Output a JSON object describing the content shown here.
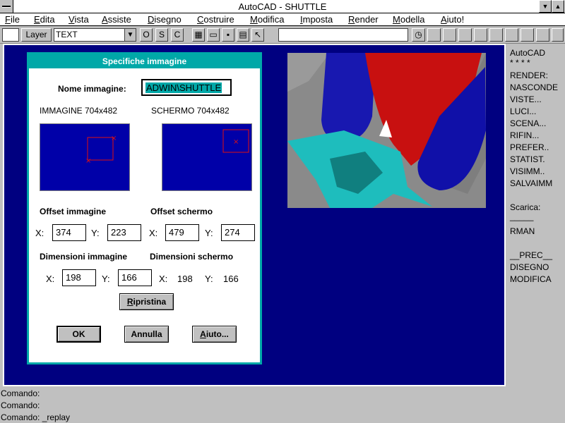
{
  "window": {
    "title": "AutoCAD - SHUTTLE"
  },
  "menu": [
    {
      "acc": "F",
      "rest": "ile"
    },
    {
      "acc": "E",
      "rest": "dita"
    },
    {
      "acc": "V",
      "rest": "ista"
    },
    {
      "acc": "A",
      "rest": "ssiste"
    },
    {
      "acc": "D",
      "rest": "isegno"
    },
    {
      "acc": "C",
      "rest": "ostruire"
    },
    {
      "acc": "M",
      "rest": "odifica"
    },
    {
      "acc": "I",
      "rest": "mposta"
    },
    {
      "acc": "R",
      "rest": "ender"
    },
    {
      "acc": "M",
      "rest": "odella"
    },
    {
      "acc": "A",
      "rest": "iuto!"
    }
  ],
  "toolbar": {
    "layer_button": "Layer",
    "layer_value": "TEXT",
    "ortho": "O",
    "snap": "S",
    "coords": "C",
    "command_field": ""
  },
  "dialog": {
    "title": "Specifiche immagine",
    "name_label": "Nome immagine:",
    "name_value": "ADWIN\\SHUTTLE",
    "image_label": "IMMAGINE 704x482",
    "screen_label": "SCHERMO 704x482",
    "image_offset_label": "Offset immagine",
    "screen_offset_label": "Offset schermo",
    "x_label": "X:",
    "y_label": "Y:",
    "image_offset_x": "374",
    "image_offset_y": "223",
    "screen_offset_x": "479",
    "screen_offset_y": "274",
    "image_size_label": "Dimensioni immagine",
    "screen_size_label": "Dimensioni schermo",
    "image_size_x": "198",
    "image_size_y": "166",
    "screen_size_x": "198",
    "screen_size_y": "166",
    "reset_button": {
      "acc": "R",
      "rest": "ipristina"
    },
    "ok_button": "OK",
    "cancel_button": "Annulla",
    "help_button": {
      "acc": "A",
      "rest": "iuto..."
    }
  },
  "side_menu": [
    "AutoCAD",
    "* * * *",
    "RENDER:",
    "NASCONDE",
    "VISTE...",
    "LUCI...",
    "SCENA...",
    "RIFIN...",
    "PREFER..",
    "STATIST.",
    "VISIMM..",
    "SALVAIMM",
    "",
    "Scarica:",
    "_____",
    "RMAN",
    "",
    "__PREC__",
    "DISEGNO",
    "MODIFICA"
  ],
  "command_lines": [
    "Comando:",
    "Comando:",
    "Comando: _replay"
  ],
  "colors": {
    "dialog_title": "#00a8a8",
    "drawing_bg": "#000080",
    "preview_bg": "#0000a8"
  }
}
